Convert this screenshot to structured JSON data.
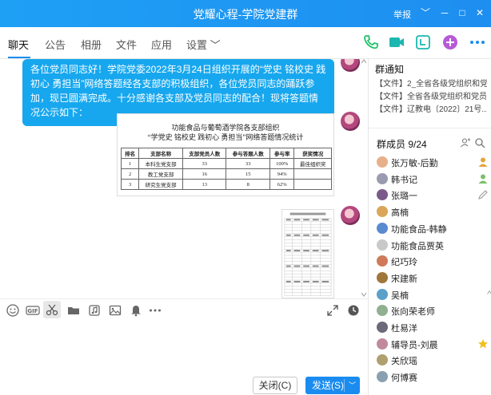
{
  "window": {
    "title": "党耀心程-学院党建群",
    "report_label": "举报",
    "dropdown_glyph": "﹀",
    "minimize_glyph": "─",
    "maximize_glyph": "□",
    "close_glyph": "✕"
  },
  "tabs": [
    {
      "label": "聊天",
      "active": true
    },
    {
      "label": "公告"
    },
    {
      "label": "相册"
    },
    {
      "label": "文件"
    },
    {
      "label": "应用"
    },
    {
      "label": "设置 ﹀"
    }
  ],
  "toolbar_icons": [
    "phone-icon",
    "video-icon",
    "classroom-icon",
    "add-app-icon",
    "more-icon"
  ],
  "message": {
    "text": "各位党员同志好！学院党委2022年3月24日组织开展的“党史 铭校史 践初心 勇担当”网络答题经各支部的积极组织，各位党员同志的踊跃参加，现已圆满完成。十分感谢各支部及党员同志的配合！现将答题情况公示如下："
  },
  "doc": {
    "heading1": "功能食品与葡萄酒学院各支部组织",
    "heading2": "“学党史 铭校史 践初心 勇担当”网络答题情况统计",
    "columns": [
      "排名",
      "支部名称",
      "支部党员人数",
      "参与答题人数",
      "参与率",
      "获奖情况"
    ],
    "rows": [
      [
        "1",
        "本科生党支部",
        "33",
        "33",
        "100%",
        "最佳组织奖"
      ],
      [
        "2",
        "教工党支部",
        "16",
        "15",
        "94%",
        ""
      ],
      [
        "3",
        "研究生党支部",
        "13",
        "8",
        "62%",
        ""
      ]
    ]
  },
  "compose": {
    "tools": [
      "emoji-icon",
      "gif-icon",
      "scissors-icon",
      "folder-icon",
      "music-icon",
      "image-icon",
      "bell-icon",
      "more-icon"
    ],
    "close_label": "关闭(C)",
    "send_label": "发送(S)",
    "send_arrow": "﹀"
  },
  "notice": {
    "title": "群通知",
    "items": [
      "【文件】2_全省各级党组织和党...",
      "【文件】全省各级党组织和党员...",
      "【文件】辽教电〔2022〕21号..."
    ]
  },
  "members": {
    "title": "群成员 9/24",
    "list": [
      {
        "name": "张万敏-后勤",
        "badge": "owner-icon",
        "badge_color": "#e3a53c"
      },
      {
        "name": "韩书记",
        "badge": "owner-icon",
        "badge_color": "#7bbf6a"
      },
      {
        "name": "张璐一",
        "badge": "edit-icon",
        "badge_color": "#999999"
      },
      {
        "name": "高楠",
        "badge": ""
      },
      {
        "name": "功能食品-韩静",
        "badge": ""
      },
      {
        "name": "功能食品贾英",
        "badge": ""
      },
      {
        "name": "纪巧玲",
        "badge": ""
      },
      {
        "name": "宋建新",
        "badge": ""
      },
      {
        "name": "吴楠",
        "badge": ""
      },
      {
        "name": "张向荣老师",
        "badge": ""
      },
      {
        "name": "杜易洋",
        "badge": ""
      },
      {
        "name": "辅导员-刘晨",
        "badge": "star-icon",
        "badge_color": "#f0c020"
      },
      {
        "name": "关欣瑶",
        "badge": ""
      },
      {
        "name": "何博赛",
        "badge": ""
      }
    ]
  }
}
